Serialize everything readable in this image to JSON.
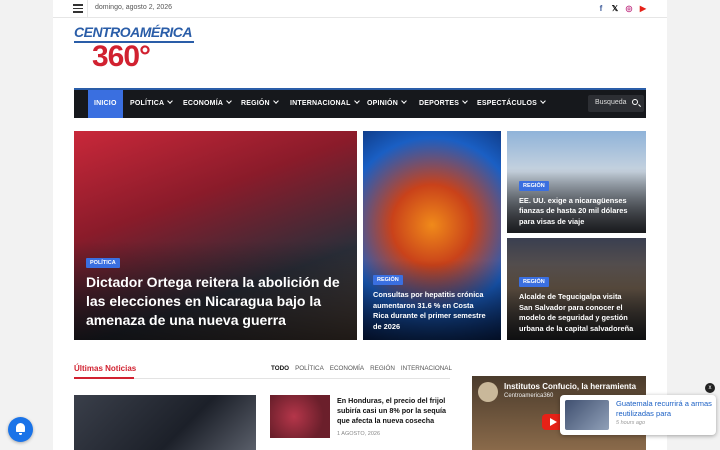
{
  "topbar": {
    "date": "domingo, agosto 2, 2026",
    "social": [
      {
        "icon": "facebook-icon",
        "glyph": "f",
        "color": "#3b5998"
      },
      {
        "icon": "x-icon",
        "glyph": "𝕏",
        "color": "#000000"
      },
      {
        "icon": "instagram-icon",
        "glyph": "◎",
        "color": "#c13584"
      },
      {
        "icon": "youtube-icon",
        "glyph": "▶",
        "color": "#e62117"
      }
    ]
  },
  "logo": {
    "line1": "CENTROAMÉRICA",
    "line2": "360°"
  },
  "nav": {
    "items": [
      {
        "label": "INICIO",
        "active": true
      },
      {
        "label": "POLÍTICA"
      },
      {
        "label": "ECONOMÍA"
      },
      {
        "label": "REGIÓN"
      },
      {
        "label": "INTERNACIONAL"
      },
      {
        "label": "OPINIÓN"
      },
      {
        "label": "DEPORTES"
      },
      {
        "label": "ESPECTÁCULOS"
      }
    ],
    "search_placeholder": "Busqueda"
  },
  "hero": [
    {
      "category": "POLÍTICA",
      "title": "Dictador Ortega reitera la abolición de las elecciones en Nicaragua bajo la amenaza de una nueva guerra"
    },
    {
      "category": "REGIÓN",
      "title": "Consultas por hepatitis crónica aumentaron 31.6 % en Costa Rica durante el primer semestre de 2026"
    },
    {
      "category": "REGIÓN",
      "title": "EE. UU. exige a nicaragüenses fianzas de hasta 20 mil dólares para visas de viaje"
    },
    {
      "category": "REGIÓN",
      "title": "Alcalde de Tegucigalpa visita San Salvador para conocer el modelo de seguridad y gestión urbana de la capital salvadoreña"
    }
  ],
  "latest": {
    "heading": "Últimas Noticias",
    "filters": [
      "TODO",
      "POLÍTICA",
      "ECONOMÍA",
      "REGIÓN",
      "INTERNACIONAL"
    ],
    "article": {
      "title": "En Honduras, el precio del frijol subiría casi un 8% por la sequía que afecta la nueva cosecha",
      "date": "1 AGOSTO, 2026"
    }
  },
  "video": {
    "title": "Institutos Confucio, la herramienta",
    "channel": "Centroamerica360"
  },
  "popup": {
    "title": "Guatemala recurrirá a armas reutilizadas para",
    "time": "5 hours ago",
    "close": "x"
  },
  "colors": {
    "accent": "#3a6fe0",
    "brand_red": "#d12130",
    "brand_blue": "#2a5da8"
  }
}
